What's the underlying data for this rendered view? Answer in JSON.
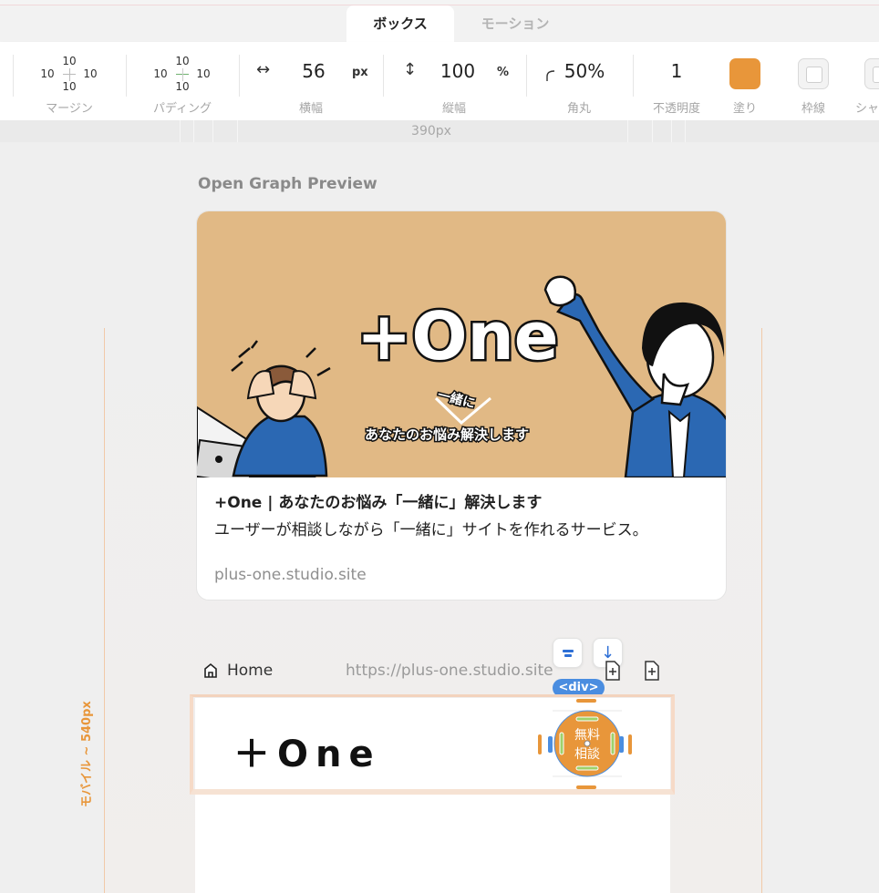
{
  "tabs": [
    {
      "label": "ボックス",
      "active": true
    },
    {
      "label": "モーション",
      "active": false
    }
  ],
  "toolbar": {
    "margin": {
      "top": "10",
      "left": "10",
      "right": "10",
      "bottom": "10",
      "label": "マージン"
    },
    "padding": {
      "top": "10",
      "left": "10",
      "right": "10",
      "bottom": "10",
      "label": "パディング"
    },
    "width": {
      "value": "56",
      "unit": "px",
      "label": "横幅",
      "icon": "horizontal-arrows-icon"
    },
    "height": {
      "value": "100",
      "unit": "%",
      "label": "縦幅",
      "icon": "vertical-arrows-icon"
    },
    "radius": {
      "value": "50%",
      "label": "角丸",
      "icon": "corner-radius-icon"
    },
    "opacity": {
      "value": "1",
      "label": "不透明度"
    },
    "fill": {
      "label": "塗り",
      "color": "#e8963a"
    },
    "stroke": {
      "label": "枠線"
    },
    "shadow": {
      "label": "シャ"
    }
  },
  "ruler": {
    "label": "390px"
  },
  "breakpoint": {
    "label": "モバイル ~ 540px",
    "color": "#e8963a"
  },
  "og": {
    "section_title": "Open Graph Preview",
    "image": {
      "logo": "+One",
      "tag": "一緒に",
      "tagline": "あなたのお悩み解決します",
      "background": "#e1b985"
    },
    "title": "+One | あなたのお悩み「一緒に」解決します",
    "description": "ユーザーが相談しながら「一緒に」サイトを作れるサービス。",
    "url": "plus-one.studio.site"
  },
  "page_bar": {
    "home_label": "Home",
    "url": "https://plus-one.studio.site",
    "element_badge": "<div>"
  },
  "preview": {
    "logo": "＋One",
    "button_line1": "無料",
    "button_line2": "相談"
  }
}
